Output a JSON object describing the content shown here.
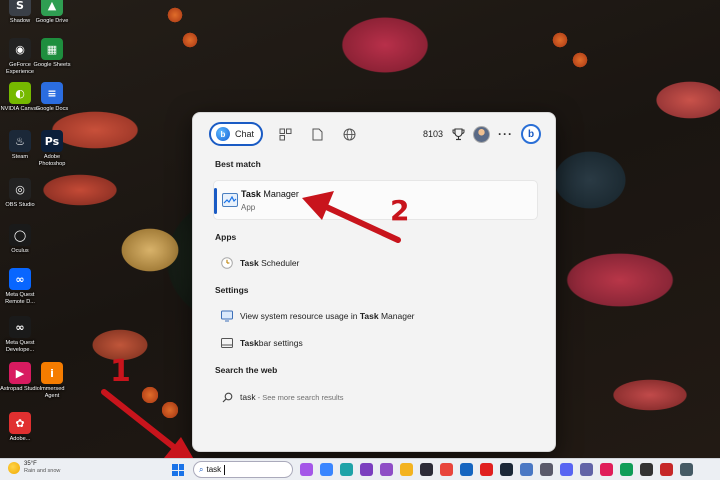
{
  "desktop": {
    "icons": [
      {
        "label": "Shadow",
        "color": "#3a3f47",
        "glyph": "S"
      },
      {
        "label": "Google Drive",
        "color": "#2f9e52",
        "glyph": "▲"
      },
      {
        "label": "GeForce Experience",
        "color": "#222222",
        "glyph": "◉"
      },
      {
        "label": "Google Sheets",
        "color": "#1e8e3e",
        "glyph": "▦"
      },
      {
        "label": "NVIDIA Canvas",
        "color": "#76b900",
        "glyph": "◐"
      },
      {
        "label": "Google Docs",
        "color": "#2b6de0",
        "glyph": "≡"
      },
      {
        "label": "Steam",
        "color": "#1b2838",
        "glyph": "♨"
      },
      {
        "label": "Adobe Photoshop",
        "color": "#0b1f3a",
        "glyph": "Ps"
      },
      {
        "label": "OBS Studio",
        "color": "#222222",
        "glyph": "◎"
      },
      {
        "label": "Oculus",
        "color": "#1a1a1a",
        "glyph": "◯"
      },
      {
        "label": "Meta Quest Remote D...",
        "color": "#0866ff",
        "glyph": "∞"
      },
      {
        "label": "Meta Quest Develope...",
        "color": "#1a1a1a",
        "glyph": "∞"
      },
      {
        "label": "Astropad Studio",
        "color": "#d81b60",
        "glyph": "▶"
      },
      {
        "label": "Immersed Agent",
        "color": "#f57c00",
        "glyph": "i"
      },
      {
        "label": "Adobe...",
        "color": "#e03030",
        "glyph": "✿"
      }
    ]
  },
  "search_panel": {
    "chat_label": "Chat",
    "points": "8103",
    "more_label": "···",
    "best_match_heading": "Best match",
    "best_match": {
      "name_bold": "Task",
      "name_rest": " Manager",
      "type": "App"
    },
    "apps_heading": "Apps",
    "apps": [
      {
        "bold": "Task",
        "rest": " Scheduler"
      }
    ],
    "settings_heading": "Settings",
    "settings": [
      {
        "pre": "View system resource usage in ",
        "bold": "Task",
        "rest": " Manager"
      },
      {
        "pre": "",
        "bold": "Task",
        "rest": "bar settings"
      }
    ],
    "web_heading": "Search the web",
    "web": {
      "query": "task",
      "hint": " - See more search results"
    }
  },
  "annotations": {
    "step1": "1",
    "step2": "2",
    "color": "#c8141c"
  },
  "taskbar": {
    "weather_temp": "35°F",
    "weather_cond": "Rain and snow",
    "search_query": "task",
    "pinned": [
      {
        "name": "copilot",
        "color": "#a457e8"
      },
      {
        "name": "widgets",
        "color": "#3a86ff"
      },
      {
        "name": "edge",
        "color": "#1fa3a8"
      },
      {
        "name": "onenote",
        "color": "#7b3fbf"
      },
      {
        "name": "app-purple",
        "color": "#8e4ec6"
      },
      {
        "name": "files",
        "color": "#f3b320"
      },
      {
        "name": "teams-dark",
        "color": "#2b2b38"
      },
      {
        "name": "chrome",
        "color": "#e8453c"
      },
      {
        "name": "outlook",
        "color": "#1565c0"
      },
      {
        "name": "app-red",
        "color": "#e02020"
      },
      {
        "name": "steam",
        "color": "#1b2838"
      },
      {
        "name": "monitor",
        "color": "#4a78c4"
      },
      {
        "name": "app-gray",
        "color": "#5a5a6a"
      },
      {
        "name": "discord",
        "color": "#5865f2"
      },
      {
        "name": "teams",
        "color": "#6264a7"
      },
      {
        "name": "slack",
        "color": "#e01e5a"
      },
      {
        "name": "photos",
        "color": "#0f9d58"
      },
      {
        "name": "app-dark",
        "color": "#333333"
      },
      {
        "name": "bt",
        "color": "#c62828"
      },
      {
        "name": "app-last",
        "color": "#455a64"
      }
    ]
  }
}
